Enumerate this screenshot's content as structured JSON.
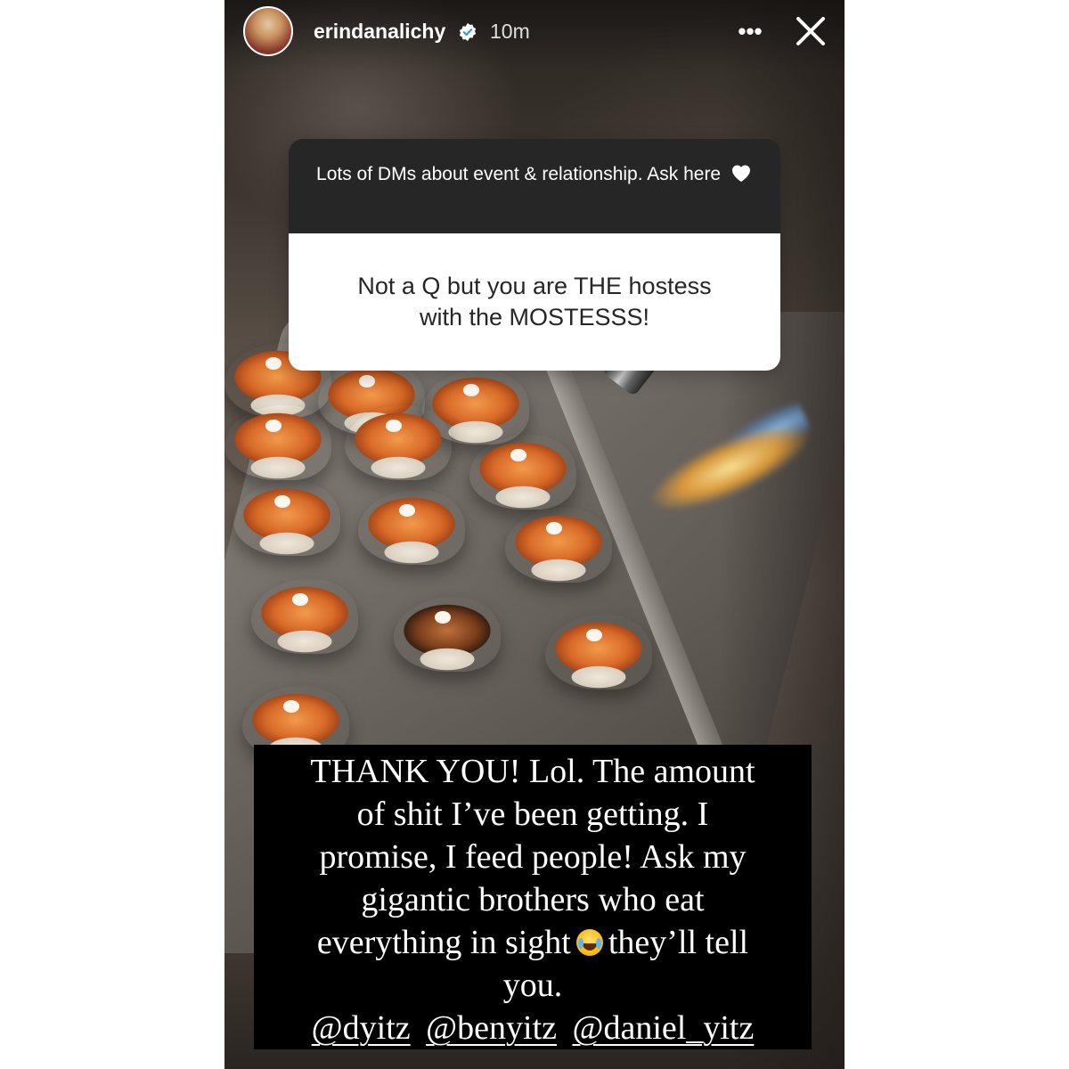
{
  "header": {
    "username": "erindanalichy",
    "time": "10m",
    "more_label": "•••"
  },
  "question": {
    "prompt": "Lots of DMs about event & relationship. Ask here",
    "answer_line1": "Not a Q but you are THE hostess",
    "answer_line2": "with the MOSTESSS!"
  },
  "caption": {
    "lines": [
      "THANK YOU! Lol. The amount",
      "of shit I’ve been getting. I",
      "promise, I feed people! Ask my",
      "gigantic brothers who eat",
      "everything in sight",
      "they’ll tell",
      "you."
    ],
    "mentions": [
      "@dyitz",
      "@benyitz",
      "@daniel_yitz"
    ]
  },
  "icons": {
    "verified": "verified-badge-icon",
    "close": "close-icon",
    "heart": "white-heart-icon",
    "emoji": "tears-of-joy-emoji"
  },
  "colors": {
    "sticker_header": "#262626",
    "sticker_body": "#ffffff",
    "caption_bg": "#000000",
    "verified_blue": "#3897f0"
  }
}
